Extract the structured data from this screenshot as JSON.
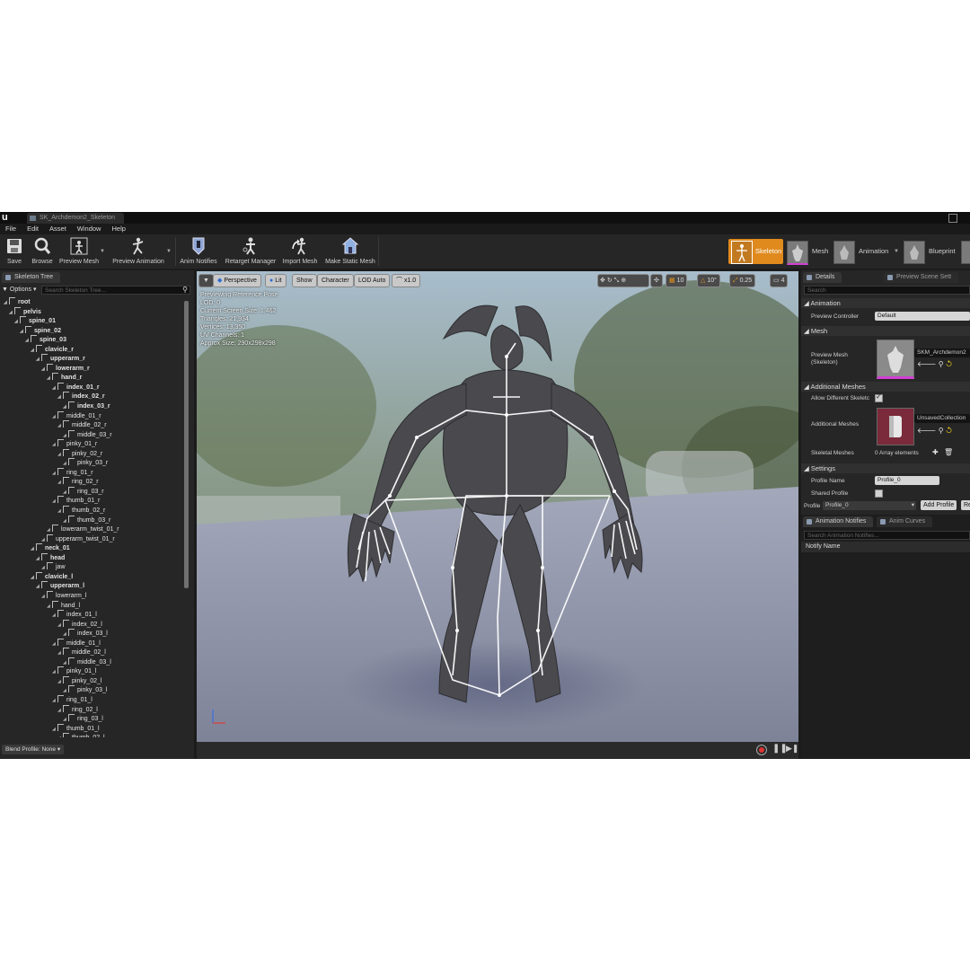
{
  "window": {
    "doc_tab": "SK_Archdemon2_Skeleton"
  },
  "menu": [
    "File",
    "Edit",
    "Asset",
    "Window",
    "Help"
  ],
  "toolbar": {
    "save": "Save",
    "browse": "Browse",
    "preview_mesh": "Preview Mesh",
    "preview_animation": "Preview Animation",
    "anim_notifies": "Anim Notifies",
    "retarget_manager": "Retarget Manager",
    "import_mesh": "Import Mesh",
    "make_static_mesh": "Make Static Mesh"
  },
  "modes": {
    "skeleton": "Skeleton",
    "mesh": "Mesh",
    "animation": "Animation",
    "blueprint": "Blueprint"
  },
  "skeleton_tree": {
    "tab": "Skeleton Tree",
    "options": "Options",
    "search_placeholder": "Search Skeleton Tree...",
    "blend_profile": "Blend Profile: None",
    "bones": [
      {
        "name": "root",
        "depth": 0
      },
      {
        "name": "pelvis",
        "depth": 1
      },
      {
        "name": "spine_01",
        "depth": 2
      },
      {
        "name": "spine_02",
        "depth": 3
      },
      {
        "name": "spine_03",
        "depth": 4
      },
      {
        "name": "clavicle_r",
        "depth": 5
      },
      {
        "name": "upperarm_r",
        "depth": 6
      },
      {
        "name": "lowerarm_r",
        "depth": 7
      },
      {
        "name": "hand_r",
        "depth": 8
      },
      {
        "name": "index_01_r",
        "depth": 9
      },
      {
        "name": "index_02_r",
        "depth": 10
      },
      {
        "name": "index_03_r",
        "depth": 11
      },
      {
        "name": "middle_01_r",
        "depth": 9
      },
      {
        "name": "middle_02_r",
        "depth": 10
      },
      {
        "name": "middle_03_r",
        "depth": 11
      },
      {
        "name": "pinky_01_r",
        "depth": 9
      },
      {
        "name": "pinky_02_r",
        "depth": 10
      },
      {
        "name": "pinky_03_r",
        "depth": 11
      },
      {
        "name": "ring_01_r",
        "depth": 9
      },
      {
        "name": "ring_02_r",
        "depth": 10
      },
      {
        "name": "ring_03_r",
        "depth": 11
      },
      {
        "name": "thumb_01_r",
        "depth": 9
      },
      {
        "name": "thumb_02_r",
        "depth": 10
      },
      {
        "name": "thumb_03_r",
        "depth": 11
      },
      {
        "name": "lowerarm_twist_01_r",
        "depth": 8
      },
      {
        "name": "upperarm_twist_01_r",
        "depth": 7
      },
      {
        "name": "neck_01",
        "depth": 5
      },
      {
        "name": "head",
        "depth": 6
      },
      {
        "name": "jaw",
        "depth": 7
      },
      {
        "name": "clavicle_l",
        "depth": 5
      },
      {
        "name": "upperarm_l",
        "depth": 6
      },
      {
        "name": "lowerarm_l",
        "depth": 7
      },
      {
        "name": "hand_l",
        "depth": 8
      },
      {
        "name": "index_01_l",
        "depth": 9
      },
      {
        "name": "index_02_l",
        "depth": 10
      },
      {
        "name": "index_03_l",
        "depth": 11
      },
      {
        "name": "middle_01_l",
        "depth": 9
      },
      {
        "name": "middle_02_l",
        "depth": 10
      },
      {
        "name": "middle_03_l",
        "depth": 11
      },
      {
        "name": "pinky_01_l",
        "depth": 9
      },
      {
        "name": "pinky_02_l",
        "depth": 10
      },
      {
        "name": "pinky_03_l",
        "depth": 11
      },
      {
        "name": "ring_01_l",
        "depth": 9
      },
      {
        "name": "ring_02_l",
        "depth": 10
      },
      {
        "name": "ring_03_l",
        "depth": 11
      },
      {
        "name": "thumb_01_l",
        "depth": 9
      },
      {
        "name": "thumb_02_l",
        "depth": 10
      }
    ]
  },
  "viewport": {
    "perspective": "Perspective",
    "lit": "Lit",
    "show": "Show",
    "character": "Character",
    "lod": "LOD Auto",
    "speed": "x1.0",
    "snap_grid": "10",
    "snap_angle": "10°",
    "snap_scale": "0.25",
    "camera_speed": "4",
    "info": [
      "Previewing Reference Pose",
      "LOD: 0",
      "Current Screen Size: 1.462",
      "Triangles: 21,934",
      "Vertices: 13,350",
      "UV Channels: 1",
      "Approx Size: 290x298x298"
    ]
  },
  "details": {
    "tab": "Details",
    "tab2": "Preview Scene Sett",
    "search_placeholder": "Search",
    "animation_section": "Animation",
    "preview_controller_label": "Preview Controller",
    "preview_controller_value": "Default",
    "mesh_section": "Mesh",
    "preview_mesh_label": "Preview Mesh",
    "preview_mesh_sub": "(Skeleton)",
    "preview_mesh_value": "SKM_Archdemon2",
    "additional_section": "Additional Meshes",
    "allow_different_label": "Allow Different Skeletc",
    "additional_meshes_label": "Additional Meshes",
    "additional_meshes_value": "UnsavedCollection",
    "skeletal_meshes_label": "Skeletal Meshes",
    "skeletal_meshes_value": "0 Array elements",
    "settings_section": "Settings",
    "profile_name_label": "Profile Name",
    "profile_name_value": "Profile_0",
    "shared_profile_label": "Shared Profile",
    "profile_label": "Profile",
    "profile_value": "Profile_0",
    "add_profile": "Add Profile",
    "remove_profile": "Re"
  },
  "notifies": {
    "tab": "Animation Notifies",
    "tab2": "Anim Curves",
    "search_placeholder": "Search Animation Notifies...",
    "header": "Notify Name"
  },
  "colors": {
    "accent": "#e08a1e",
    "panel": "#262626",
    "floor": "#8d93a8"
  }
}
